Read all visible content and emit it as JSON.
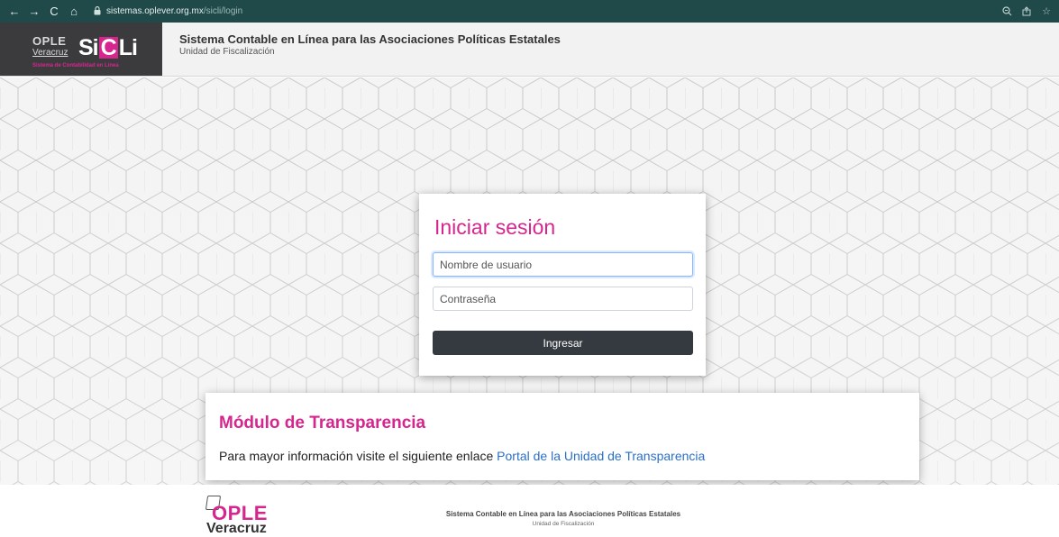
{
  "browser": {
    "back_icon": "←",
    "forward_icon": "→",
    "reload_icon": "C",
    "home_icon": "⌂",
    "lock_icon": "🔒",
    "url_domain": "sistemas.oplever.org.mx",
    "url_path": "/sicli/login",
    "zoom_icon": "⊕",
    "share_icon": "⇪",
    "bookmark_icon": "☆"
  },
  "header": {
    "logo_ople": "OPLE",
    "logo_veracruz": "Veracruz",
    "logo_si": "Si",
    "logo_c": "C",
    "logo_li": "Li",
    "logo_tagline": "Sistema de Contabilidad en Línea",
    "title": "Sistema Contable en Línea para las Asociaciones Políticas Estatales",
    "subtitle": "Unidad de Fiscalización"
  },
  "login": {
    "title": "Iniciar sesión",
    "username_placeholder": "Nombre de usuario",
    "password_placeholder": "Contraseña",
    "submit_label": "Ingresar"
  },
  "transparency": {
    "title": "Módulo de Transparencia",
    "text": "Para mayor información visite el siguiente enlace ",
    "link_label": "Portal de la Unidad de Transparencia"
  },
  "footer": {
    "logo_ople": "OPLE",
    "logo_veracruz": "Veracruz",
    "title": "Sistema Contable en Línea para las Asociaciones Políticas Estatales",
    "subtitle": "Unidad de Fiscalización"
  },
  "colors": {
    "accent": "#d6268e",
    "browser_bar": "#1f4a49",
    "button_dark": "#343a40",
    "link": "#2a6fc9"
  }
}
